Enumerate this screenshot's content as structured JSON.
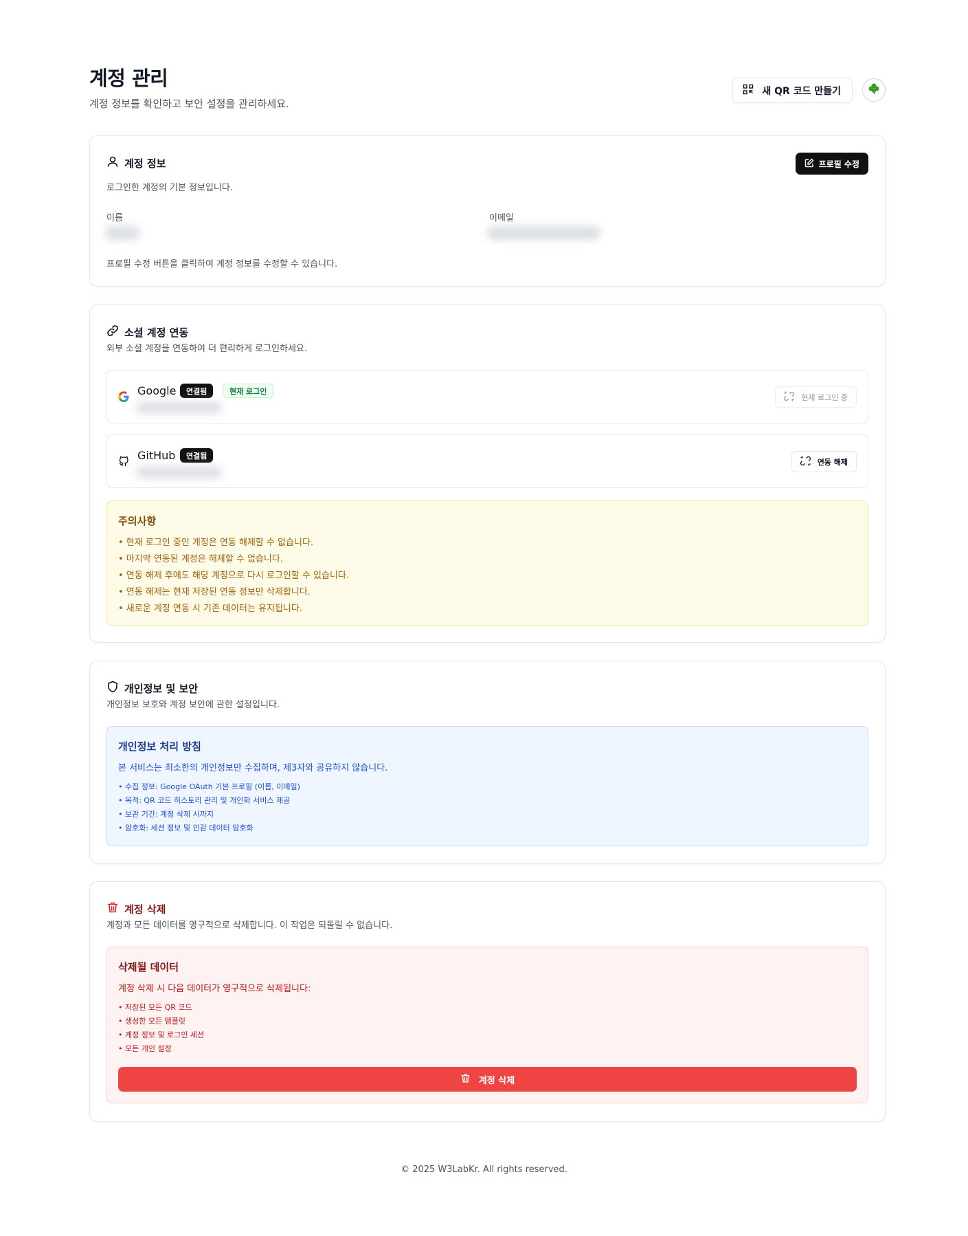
{
  "header": {
    "title": "계정 관리",
    "subtitle": "계정 정보를 확인하고 보안 설정을 관리하세요.",
    "qr_button": "새 QR 코드 만들기",
    "avatar_icon": "clover-icon"
  },
  "account_info": {
    "title": "계정 정보",
    "desc": "로그인한 계정의 기본 정보입니다.",
    "edit_button": "프로필 수정",
    "name_label": "이름",
    "email_label": "이메일",
    "hint": "프로필 수정 버튼을 클릭하여 계정 정보를 수정할 수 있습니다."
  },
  "social": {
    "title": "소셜 계정 연동",
    "desc": "외부 소셜 계정을 연동하여 더 편리하게 로그인하세요.",
    "accounts": [
      {
        "provider": "Google",
        "status": "연결됨",
        "current_badge": "현재 로그인",
        "action": "현재 로그인 중"
      },
      {
        "provider": "GitHub",
        "status": "연결됨",
        "action": "연동 해제"
      }
    ],
    "notice": {
      "title": "주의사항",
      "items": [
        "• 현재 로그인 중인 계정은 연동 해제할 수 없습니다.",
        "• 마지막 연동된 계정은 해제할 수 없습니다.",
        "• 연동 해제 후에도 해당 계정으로 다시 로그인할 수 있습니다.",
        "• 연동 해제는 현재 저장된 연동 정보만 삭제합니다.",
        "• 새로운 계정 연동 시 기존 데이터는 유지됩니다."
      ]
    }
  },
  "privacy": {
    "title": "개인정보 및 보안",
    "desc": "개인정보 보호와 계정 보안에 관한 설정입니다.",
    "policy": {
      "title": "개인정보 처리 방침",
      "lead": "본 서비스는 최소한의 개인정보만 수집하며, 제3자와 공유하지 않습니다.",
      "items": [
        "• 수집 정보: Google OAuth 기본 프로필 (이름, 이메일)",
        "• 목적: QR 코드 히스토리 관리 및 개인화 서비스 제공",
        "• 보관 기간: 계정 삭제 시까지",
        "• 암호화: 세션 정보 및 민감 데이터 암호화"
      ]
    }
  },
  "delete": {
    "title": "계정 삭제",
    "desc": "계정과 모든 데이터를 영구적으로 삭제합니다. 이 작업은 되돌릴 수 없습니다.",
    "box": {
      "title": "삭제될 데이터",
      "lead": "계정 삭제 시 다음 데이터가 영구적으로 삭제됩니다:",
      "items": [
        "• 저장된 모든 QR 코드",
        "• 생성한 모든 템플릿",
        "• 계정 정보 및 로그인 세션",
        "• 모든 개인 설정"
      ]
    },
    "button": "계정 삭제"
  },
  "footer": "© 2025 W3LabKr. All rights reserved.",
  "colors": {
    "danger": "#ef4444",
    "warning_bg": "#fefce8",
    "info_bg": "#eff6ff",
    "dark": "#111111"
  }
}
